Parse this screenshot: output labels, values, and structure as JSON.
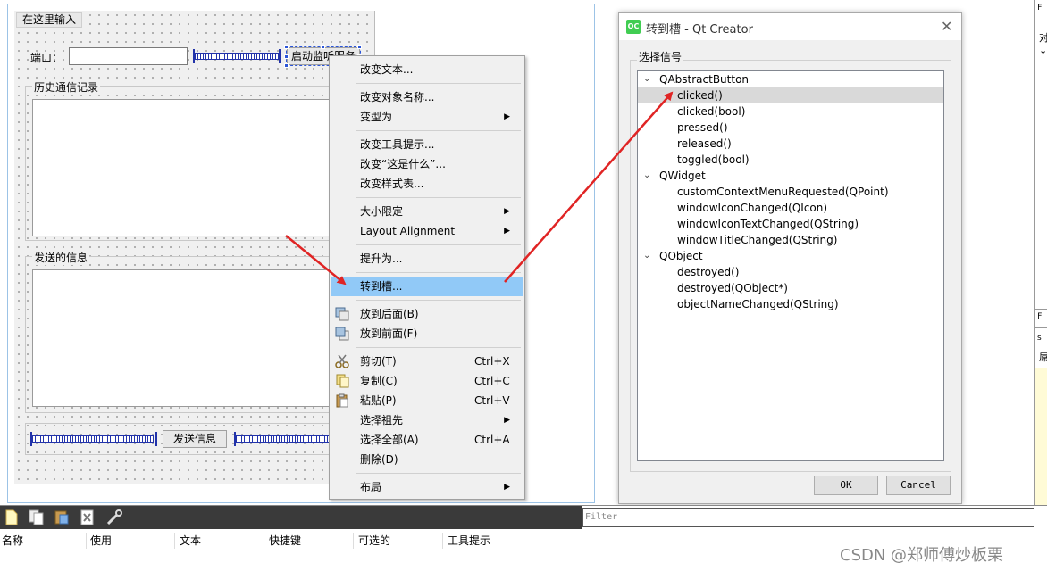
{
  "form": {
    "title": "在这里输入",
    "port_label": "端口：",
    "port_value": "",
    "start_button": "启动监听服务",
    "history_label": "历史通信记录",
    "send_label": "发送的信息",
    "send_button": "发送信息"
  },
  "context_menu": {
    "items": [
      {
        "label": "改变文本...",
        "shortcut": "",
        "submenu": false
      },
      {
        "label": "改变对象名称...",
        "shortcut": "",
        "submenu": false
      },
      {
        "label": "变型为",
        "shortcut": "",
        "submenu": true
      },
      {
        "label": "改变工具提示...",
        "shortcut": "",
        "submenu": false
      },
      {
        "label": "改变“这是什么”...",
        "shortcut": "",
        "submenu": false
      },
      {
        "label": "改变样式表...",
        "shortcut": "",
        "submenu": false
      },
      {
        "label": "大小限定",
        "shortcut": "",
        "submenu": true
      },
      {
        "label": "Layout Alignment",
        "shortcut": "",
        "submenu": true
      },
      {
        "label": "提升为...",
        "shortcut": "",
        "submenu": false
      },
      {
        "label": "转到槽...",
        "shortcut": "",
        "submenu": false,
        "highlighted": true
      },
      {
        "label": "放到后面(B)",
        "shortcut": "",
        "submenu": false,
        "icon": "send-to-back-icon"
      },
      {
        "label": "放到前面(F)",
        "shortcut": "",
        "submenu": false,
        "icon": "bring-to-front-icon"
      },
      {
        "label": "剪切(T)",
        "shortcut": "Ctrl+X",
        "submenu": false,
        "icon": "scissors-icon"
      },
      {
        "label": "复制(C)",
        "shortcut": "Ctrl+C",
        "submenu": false,
        "icon": "copy-icon"
      },
      {
        "label": "粘贴(P)",
        "shortcut": "Ctrl+V",
        "submenu": false,
        "icon": "paste-icon"
      },
      {
        "label": "选择祖先",
        "shortcut": "",
        "submenu": true
      },
      {
        "label": "选择全部(A)",
        "shortcut": "Ctrl+A",
        "submenu": false
      },
      {
        "label": "删除(D)",
        "shortcut": "",
        "submenu": false
      },
      {
        "label": "布局",
        "shortcut": "",
        "submenu": true
      }
    ]
  },
  "dialog": {
    "title": "转到槽 - Qt Creator",
    "logo_text": "QC",
    "group_label": "选择信号",
    "tree": [
      {
        "label": "QAbstractButton",
        "level": 0,
        "expanded": true
      },
      {
        "label": "clicked()",
        "level": 1,
        "selected": true
      },
      {
        "label": "clicked(bool)",
        "level": 1
      },
      {
        "label": "pressed()",
        "level": 1
      },
      {
        "label": "released()",
        "level": 1
      },
      {
        "label": "toggled(bool)",
        "level": 1
      },
      {
        "label": "QWidget",
        "level": 0,
        "expanded": true
      },
      {
        "label": "customContextMenuRequested(QPoint)",
        "level": 1
      },
      {
        "label": "windowIconChanged(QIcon)",
        "level": 1
      },
      {
        "label": "windowIconTextChanged(QString)",
        "level": 1
      },
      {
        "label": "windowTitleChanged(QString)",
        "level": 1
      },
      {
        "label": "QObject",
        "level": 0,
        "expanded": true
      },
      {
        "label": "destroyed()",
        "level": 1
      },
      {
        "label": "destroyed(QObject*)",
        "level": 1
      },
      {
        "label": "objectNameChanged(QString)",
        "level": 1
      }
    ],
    "ok_label": "OK",
    "cancel_label": "Cancel"
  },
  "right_panel": {
    "chars": [
      "F",
      "对",
      "⌄",
      "F",
      "s",
      "屌"
    ]
  },
  "action_editor": {
    "filter_placeholder": "Filter",
    "columns": [
      "名称",
      "使用",
      "文本",
      "快捷键",
      "可选的",
      "工具提示"
    ]
  },
  "watermark": "CSDN @郑师傅炒板栗",
  "colors": {
    "highlight": "#91c9f7",
    "selection_handle": "#2b55d8",
    "arrow": "#e02424",
    "qt_green": "#41cd52"
  }
}
